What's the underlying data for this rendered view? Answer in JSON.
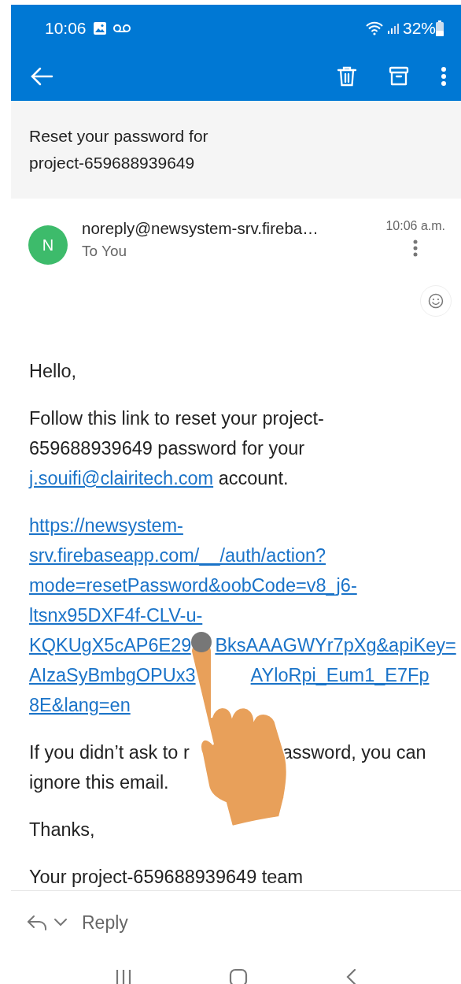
{
  "status_bar": {
    "time": "10:06",
    "battery": "32%"
  },
  "subject": "Reset your password for project-659688939649",
  "sender": {
    "avatar_letter": "N",
    "name": "noreply@newsystem-srv.fireba…",
    "recipient": "To You",
    "time": "10:06 a.m."
  },
  "body": [
    {
      "kind": "text",
      "text": "Hello,"
    },
    {
      "kind": "mixed",
      "parts": [
        {
          "text": "Follow this link to reset your project-659688939649 password for your "
        },
        {
          "link": "j.souifi@clairitech.com"
        },
        {
          "text": " account."
        }
      ]
    },
    {
      "kind": "link_block",
      "lines": [
        [
          "https://newsystem-"
        ],
        [
          "srv.firebaseapp.com/__/auth/action?"
        ],
        [
          "mode=resetPassword&oobCode=v8_j6-"
        ],
        [
          "ltsnx95DXF4f-CLV-u-"
        ],
        [
          "KQKUgX5cAP6E29",
          "BksAAAGWYr7pXg&apiKey="
        ],
        [
          "AIzaSyBmbgOPUx3",
          "AYloRpi_Eum1_E7Fp"
        ],
        [
          "8E&lang=en"
        ]
      ]
    },
    {
      "kind": "obscured",
      "lines": [
        [
          "If you didn’t ask to r",
          "assword, you can"
        ],
        [
          "ignore this email."
        ]
      ]
    },
    {
      "kind": "text",
      "text": "Thanks,"
    },
    {
      "kind": "text",
      "text": "Your project-659688939649 team"
    }
  ],
  "reply_bar": {
    "label": "Reply"
  }
}
